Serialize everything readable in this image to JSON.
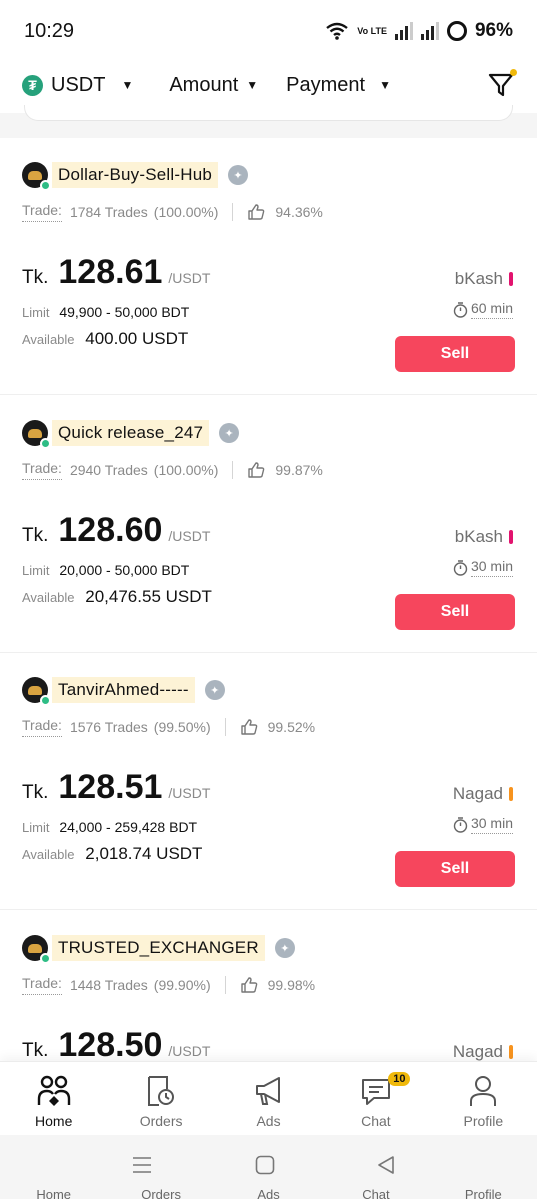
{
  "status_bar": {
    "time": "10:29",
    "network_label": "Vo LTE",
    "battery": "96%"
  },
  "filters": {
    "coin": "USDT",
    "coin_icon": "tether-icon",
    "amount": "Amount",
    "payment": "Payment"
  },
  "ads": [
    {
      "name": "Dollar-Buy-Sell-Hub",
      "trade_label": "Trade:",
      "trades": "1784 Trades",
      "completion": "(100.00%)",
      "rating": "94.36%",
      "currency": "Tk.",
      "price": "128.61",
      "unit": "/USDT",
      "payment": "bKash",
      "payment_color": "#e2136e",
      "limit_label": "Limit",
      "limit": "49,900 - 50,000 BDT",
      "available_label": "Available",
      "available": "400.00 USDT",
      "time_limit": "60 min",
      "action": "Sell"
    },
    {
      "name": "Quick release_247",
      "trade_label": "Trade:",
      "trades": "2940 Trades",
      "completion": "(100.00%)",
      "rating": "99.87%",
      "currency": "Tk.",
      "price": "128.60",
      "unit": "/USDT",
      "payment": "bKash",
      "payment_color": "#e2136e",
      "limit_label": "Limit",
      "limit": "20,000 - 50,000 BDT",
      "available_label": "Available",
      "available": "20,476.55 USDT",
      "time_limit": "30 min",
      "action": "Sell"
    },
    {
      "name": "TanvirAhmed-----",
      "trade_label": "Trade:",
      "trades": "1576 Trades",
      "completion": "(99.50%)",
      "rating": "99.52%",
      "currency": "Tk.",
      "price": "128.51",
      "unit": "/USDT",
      "payment": "Nagad",
      "payment_color": "#f7931e",
      "limit_label": "Limit",
      "limit": "24,000 - 259,428 BDT",
      "available_label": "Available",
      "available": "2,018.74 USDT",
      "time_limit": "30 min",
      "action": "Sell"
    },
    {
      "name": "TRUSTED_EXCHANGER",
      "trade_label": "Trade:",
      "trades": "1448 Trades",
      "completion": "(99.90%)",
      "rating": "99.98%",
      "currency": "Tk.",
      "price": "128.50",
      "unit": "/USDT",
      "payment": "Nagad",
      "payment_color": "#f7931e"
    }
  ],
  "bottom_nav": [
    {
      "label": "Home",
      "icon": "home-people-icon",
      "active": true
    },
    {
      "label": "Orders",
      "icon": "orders-icon"
    },
    {
      "label": "Ads",
      "icon": "megaphone-icon"
    },
    {
      "label": "Chat",
      "icon": "chat-icon",
      "badge": "10"
    },
    {
      "label": "Profile",
      "icon": "profile-icon"
    }
  ],
  "ghost_labels": [
    "Home",
    "Orders",
    "Ads",
    "Chat",
    "Profile"
  ],
  "colors": {
    "sell": "#f6465d",
    "highlight": "#fdf3d6",
    "online": "#2ebd85",
    "accent": "#f0b90b"
  }
}
